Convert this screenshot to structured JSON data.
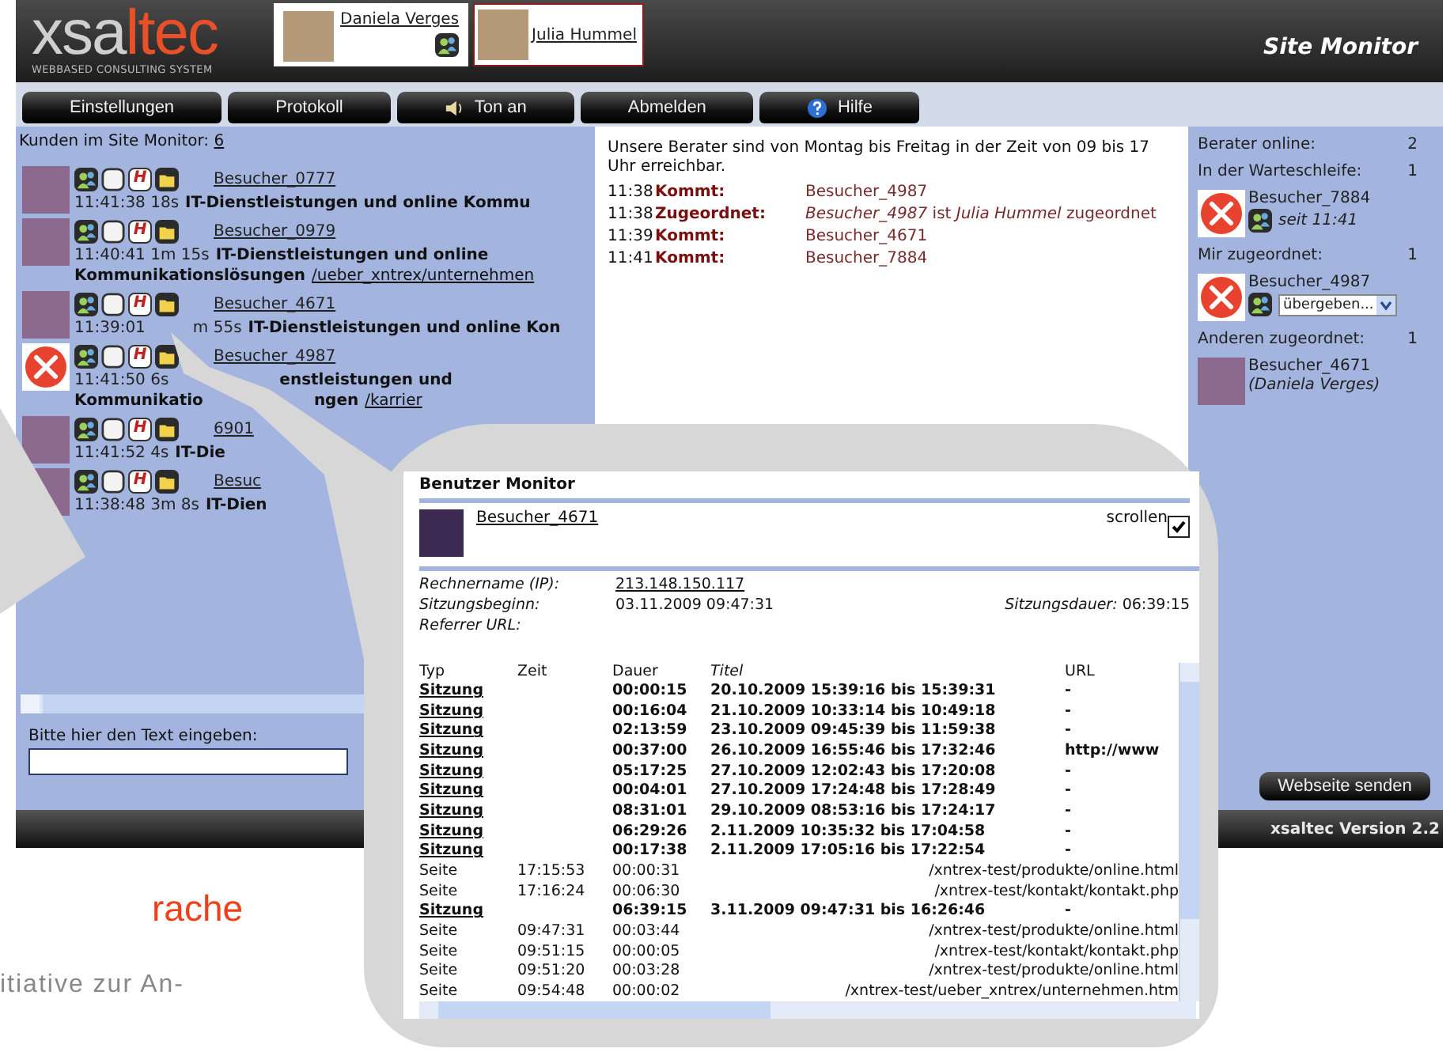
{
  "header": {
    "logo_start": "xsa",
    "logo_end": "ltec",
    "tagline": "WEBBASED CONSULTING SYSTEM",
    "title": "Site Monitor",
    "agents": [
      {
        "name": "Daniela Verges",
        "selected": false,
        "online": true
      },
      {
        "name": "Julia Hummel",
        "selected": true,
        "online": false
      }
    ]
  },
  "nav": [
    {
      "label": "Einstellungen"
    },
    {
      "label": "Protokoll"
    },
    {
      "label": "Ton an"
    },
    {
      "label": "Abmelden"
    },
    {
      "label": "Hilfe"
    }
  ],
  "visitors": {
    "label": "Kunden im Site Monitor:",
    "count": "6",
    "items": [
      {
        "kind": "photo",
        "name": "Besucher_0777",
        "badge": "H",
        "lines": [
          [
            {
              "kind": "time",
              "text": "11:41:38 18s"
            },
            {
              "kind": "title",
              "text": "IT-Dienstleistungen und online Kommu"
            }
          ]
        ]
      },
      {
        "kind": "photo",
        "name": "Besucher_0979",
        "badge": "H",
        "lines": [
          [
            {
              "kind": "time",
              "text": "11:40:41 1m 15s"
            },
            {
              "kind": "title",
              "text": "IT-Dienstleistungen und online"
            }
          ],
          [
            {
              "kind": "title",
              "text": "Kommunikationslösungen"
            },
            {
              "kind": "link",
              "text": "/ueber_xntrex/unternehmen"
            }
          ]
        ]
      },
      {
        "kind": "photo",
        "name": "Besucher_4671",
        "badge": "H",
        "lines": [
          [
            {
              "kind": "time",
              "text": "11:39:01"
            },
            {
              "kind": "gap"
            },
            {
              "kind": "time",
              "text": "m 55s"
            },
            {
              "kind": "title",
              "text": "IT-Dienstleistungen und online Kon"
            }
          ]
        ]
      },
      {
        "kind": "tools",
        "name": "Besucher_4987",
        "badge": "H",
        "lines": [
          [
            {
              "kind": "time",
              "text": "11:41:50 6s"
            },
            {
              "kind": "wide_gap"
            },
            {
              "kind": "title",
              "text": "enstleistungen und"
            }
          ],
          [
            {
              "kind": "title",
              "text": "Kommunikatio"
            },
            {
              "kind": "wide_gap"
            },
            {
              "kind": "title",
              "text": "ngen"
            },
            {
              "kind": "link",
              "text": "/karrier"
            }
          ]
        ]
      },
      {
        "kind": "photo",
        "name": "6901",
        "badge": "H",
        "lines": [
          [
            {
              "kind": "time",
              "text": "11:41:52 4s"
            },
            {
              "kind": "title",
              "text": "IT-Die"
            }
          ]
        ]
      },
      {
        "kind": "photo",
        "name": "Besuc",
        "badge": "H",
        "lines": [
          [
            {
              "kind": "time",
              "text": "11:38:48 3m 8s"
            },
            {
              "kind": "title",
              "text": "IT-Dien"
            }
          ]
        ]
      }
    ]
  },
  "notice": "Unsere Berater sind von Montag bis Freitag in der Zeit von 09 bis 17 Uhr erreichbar.",
  "log": [
    {
      "time": "11:38",
      "event": "Kommt:",
      "detail": "Besucher_4987"
    },
    {
      "time": "11:38",
      "event": "Zugeordnet:",
      "detail": "*Besucher_4987* ist *Julia Hummel* zugeordnet"
    },
    {
      "time": "11:39",
      "event": "Kommt:",
      "detail": "Besucher_4671"
    },
    {
      "time": "11:41",
      "event": "Kommt:",
      "detail": "Besucher_7884"
    }
  ],
  "stats": [
    {
      "label": "Berater online:",
      "count": "2"
    },
    {
      "label": "In der Warteschleife:",
      "count": "1",
      "entry": {
        "kind": "waiting",
        "name": "Besucher_7884",
        "note": "seit 11:41"
      }
    },
    {
      "label": "Mir zugeordnet:",
      "count": "1",
      "entry": {
        "kind": "assigned",
        "name": "Besucher_4987",
        "select": "übergeben..."
      }
    },
    {
      "label": "Anderen zugeordnet:",
      "count": "1",
      "entry": {
        "kind": "other",
        "name": "Besucher_4671",
        "note": "(Daniela Verges)"
      }
    }
  ],
  "input_label": "Bitte hier den Text eingeben:",
  "send_button": "Webseite senden",
  "footer": "xsaltec Version 2.2",
  "document": {
    "heading": "rache",
    "text": "itiative zur An-"
  },
  "monitor": {
    "title": "Benutzer Monitor",
    "visitor": "Besucher_4671",
    "scroll_label": "scrollen",
    "scroll_checked": true,
    "fields": [
      {
        "label": "Rechnername (IP):",
        "value": "213.148.150.117",
        "kind": "link"
      },
      {
        "label": "Sitzungsbeginn:",
        "value": "03.11.2009 09:47:31",
        "kind": "plain"
      }
    ],
    "duration_label": "Sitzungsdauer:",
    "duration": "06:39:15",
    "referrer_label": "Referrer URL:",
    "columns": [
      "Typ",
      "Zeit",
      "Dauer",
      "Titel",
      "URL"
    ],
    "rows": [
      {
        "kind": "session",
        "type": "Sitzung",
        "duration": "00:00:15",
        "title": "20.10.2009 15:39:16 bis 15:39:31",
        "url": "-"
      },
      {
        "kind": "session",
        "type": "Sitzung",
        "duration": "00:16:04",
        "title": "21.10.2009 10:33:14 bis 10:49:18",
        "url": "-"
      },
      {
        "kind": "session",
        "type": "Sitzung",
        "duration": "02:13:59",
        "title": "23.10.2009 09:45:39 bis 11:59:38",
        "url": "-"
      },
      {
        "kind": "session",
        "type": "Sitzung",
        "duration": "00:37:00",
        "title": "26.10.2009 16:55:46 bis 17:32:46",
        "url": "http://www"
      },
      {
        "kind": "session",
        "type": "Sitzung",
        "duration": "05:17:25",
        "title": "27.10.2009 12:02:43 bis 17:20:08",
        "url": "-"
      },
      {
        "kind": "session",
        "type": "Sitzung",
        "duration": "00:04:01",
        "title": "27.10.2009 17:24:48 bis 17:28:49",
        "url": "-"
      },
      {
        "kind": "session",
        "type": "Sitzung",
        "duration": "08:31:01",
        "title": "29.10.2009 08:53:16 bis 17:24:17",
        "url": "-"
      },
      {
        "kind": "session",
        "type": "Sitzung",
        "duration": "06:29:26",
        "title": "2.11.2009 10:35:32 bis 17:04:58",
        "url": "-"
      },
      {
        "kind": "session",
        "type": "Sitzung",
        "duration": "00:17:38",
        "title": "2.11.2009 17:05:16 bis 17:22:54",
        "url": "-"
      },
      {
        "kind": "page",
        "type": "Seite",
        "time": "17:15:53",
        "duration": "00:00:31",
        "url": "/xntrex-test/produkte/online.html"
      },
      {
        "kind": "page",
        "type": "Seite",
        "time": "17:16:24",
        "duration": "00:06:30",
        "url": "/xntrex-test/kontakt/kontakt.php"
      },
      {
        "kind": "session",
        "type": "Sitzung",
        "duration": "06:39:15",
        "title": "3.11.2009 09:47:31 bis 16:26:46",
        "url": "-"
      },
      {
        "kind": "page",
        "type": "Seite",
        "time": "09:47:31",
        "duration": "00:03:44",
        "url": "/xntrex-test/produkte/online.html"
      },
      {
        "kind": "page",
        "type": "Seite",
        "time": "09:51:15",
        "duration": "00:00:05",
        "url": "/xntrex-test/kontakt/kontakt.php"
      },
      {
        "kind": "page",
        "type": "Seite",
        "time": "09:51:20",
        "duration": "00:03:28",
        "url": "/xntrex-test/produkte/online.html"
      },
      {
        "kind": "page",
        "type": "Seite",
        "time": "09:54:48",
        "duration": "00:00:02",
        "url": "/xntrex-test/ueber_xntrex/unternehmen.htm"
      }
    ]
  }
}
